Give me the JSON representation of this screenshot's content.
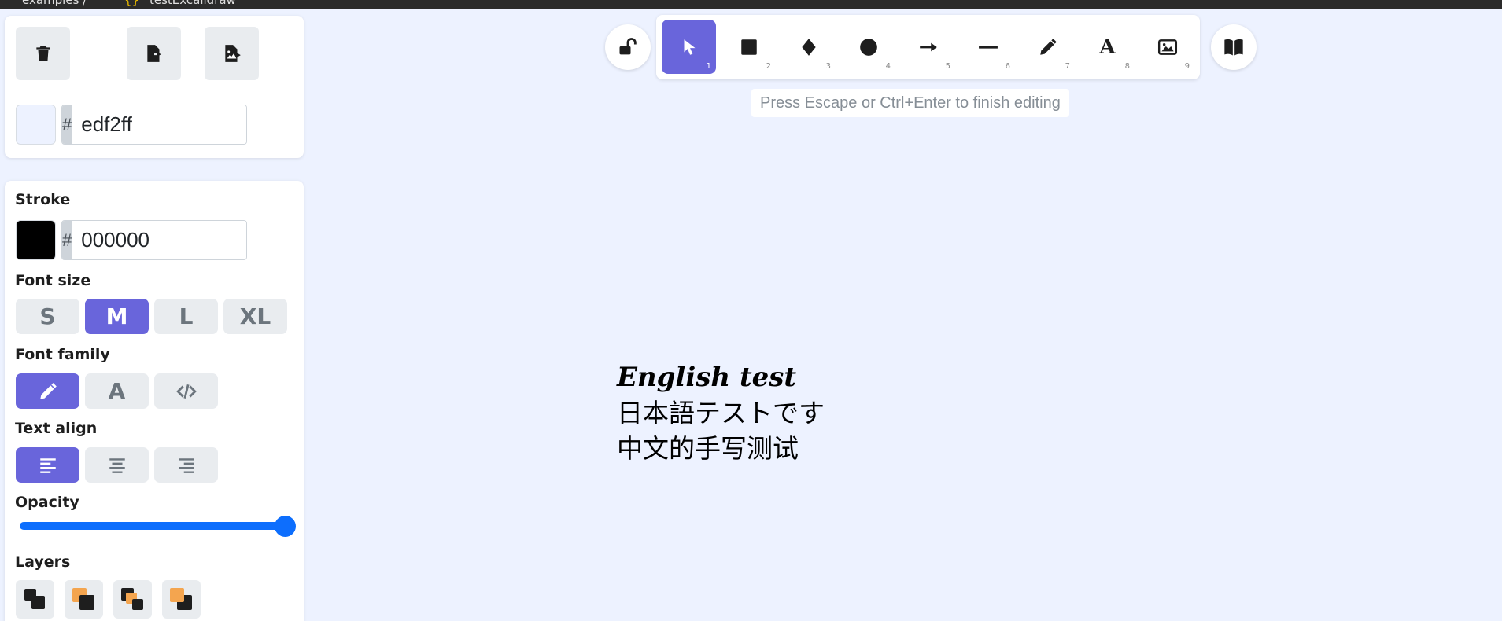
{
  "window": {
    "breadcrumb": "examples /",
    "file_name": "testExcalidraw"
  },
  "top_panel": {
    "delete_icon": "trash-icon",
    "export_icon": "file-export-icon",
    "export_image_icon": "file-image-export-icon",
    "background_color": "#edf2ff",
    "background_hex_prefix": "#",
    "background_hex_value": "edf2ff"
  },
  "props": {
    "stroke_label": "Stroke",
    "stroke_color": "#000000",
    "stroke_hex_prefix": "#",
    "stroke_hex_value": "000000",
    "font_size_label": "Font size",
    "font_sizes": [
      "S",
      "M",
      "L",
      "XL"
    ],
    "font_size_selected": "M",
    "font_family_label": "Font family",
    "font_family_options": [
      "hand-drawn-icon",
      "A",
      "code-icon"
    ],
    "font_family_selected": "hand-drawn",
    "font_family_normal_label": "A",
    "text_align_label": "Text align",
    "text_align_options": [
      "align-left-icon",
      "align-center-icon",
      "align-right-icon"
    ],
    "text_align_selected": "left",
    "opacity_label": "Opacity",
    "opacity_value": 100,
    "layers_label": "Layers",
    "layer_buttons": [
      "send-to-back-icon",
      "send-backward-icon",
      "bring-forward-icon",
      "bring-to-front-icon"
    ]
  },
  "toolbar": {
    "lock_icon": "unlock-icon",
    "tools": [
      {
        "name": "selection",
        "icon": "cursor-icon",
        "shortcut": "1",
        "active": true
      },
      {
        "name": "rectangle",
        "icon": "square-icon",
        "shortcut": "2"
      },
      {
        "name": "diamond",
        "icon": "diamond-icon",
        "shortcut": "3"
      },
      {
        "name": "ellipse",
        "icon": "circle-icon",
        "shortcut": "4"
      },
      {
        "name": "arrow",
        "icon": "arrow-icon",
        "shortcut": "5"
      },
      {
        "name": "line",
        "icon": "line-icon",
        "shortcut": "6"
      },
      {
        "name": "freedraw",
        "icon": "pencil-icon",
        "shortcut": "7"
      },
      {
        "name": "text",
        "icon": "text-icon",
        "shortcut": "8"
      },
      {
        "name": "image",
        "icon": "image-icon",
        "shortcut": "9"
      }
    ],
    "text_tool_glyph": "A",
    "library_icon": "book-icon"
  },
  "hint": "Press Escape or Ctrl+Enter to finish editing",
  "canvas": {
    "lines": [
      "English test",
      "日本語テストです",
      "中文的手写测试"
    ]
  },
  "colors": {
    "accent": "#6965db",
    "slider": "#0d6efd",
    "canvas_bg": "#edf2ff"
  }
}
